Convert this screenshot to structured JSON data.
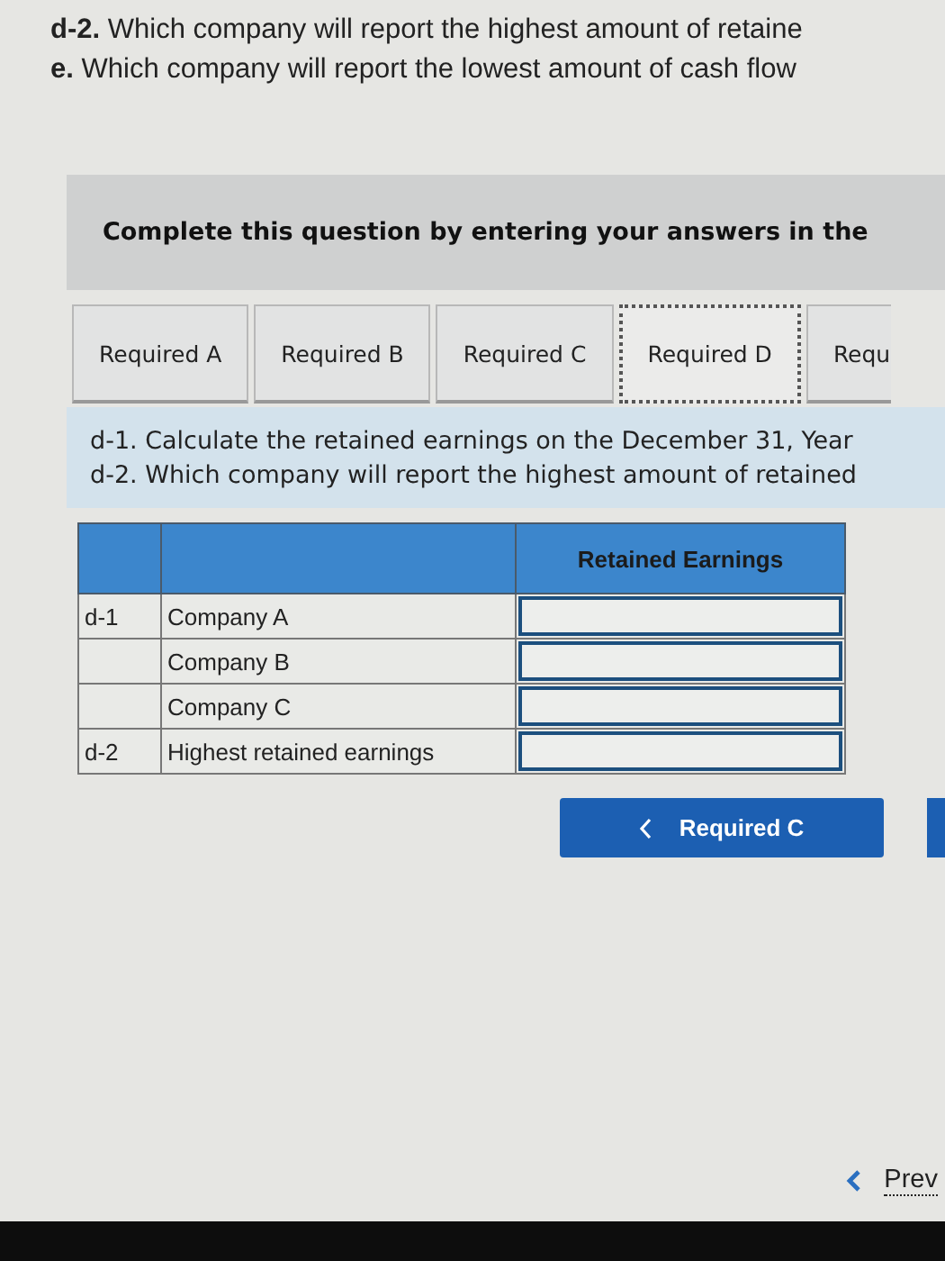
{
  "question_lines": [
    "**d-2.** Which company will report the highest amount of retaine",
    "**e.** Which company will report the lowest amount of cash flow"
  ],
  "instruction": "Complete this question by entering your answers in the",
  "tabs": [
    {
      "label": "Required A",
      "selected": false
    },
    {
      "label": "Required B",
      "selected": false
    },
    {
      "label": "Required C",
      "selected": false
    },
    {
      "label": "Required D",
      "selected": true
    },
    {
      "label": "Requ",
      "selected": false
    }
  ],
  "panel_lines": [
    "d-1. Calculate the retained earnings on the December 31, Year",
    "d-2. Which company will report the highest amount of retained"
  ],
  "table": {
    "header": "Retained Earnings",
    "rows": [
      {
        "part": "d-1",
        "label": "Company A"
      },
      {
        "label": "Company B"
      },
      {
        "label": "Company C"
      },
      {
        "part": "d-2",
        "label": "Highest retained earnings"
      }
    ]
  },
  "back_button": "Required C",
  "prev_link": "Prev"
}
